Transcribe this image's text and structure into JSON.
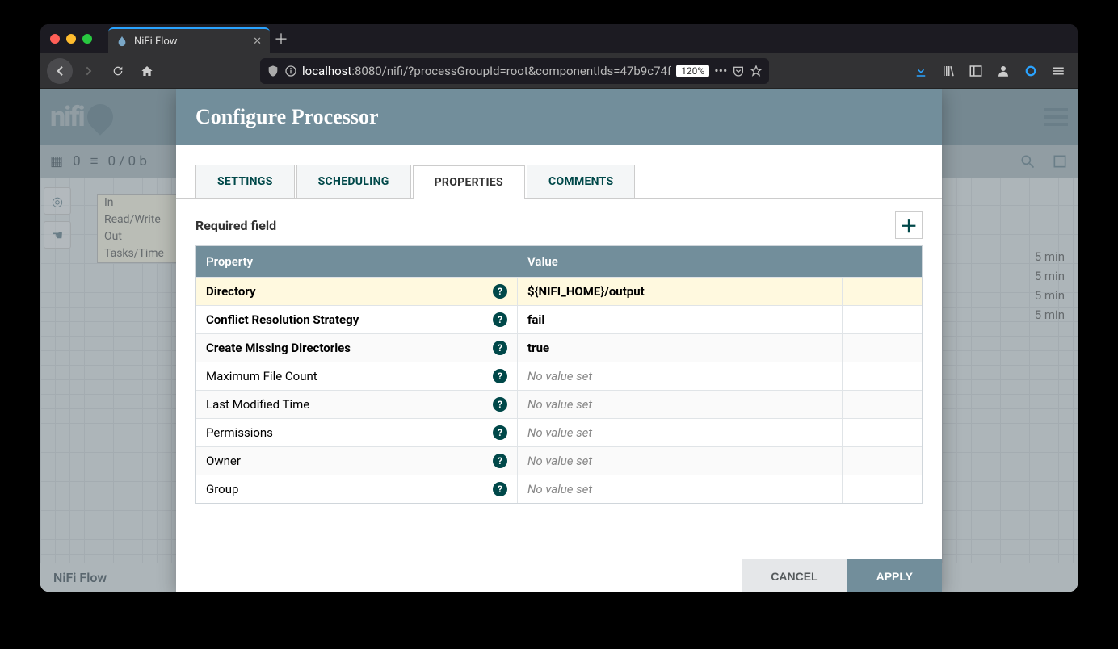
{
  "browser": {
    "tab_title": "NiFi Flow",
    "url_host": "localhost",
    "url_rest": ":8080/nifi/?processGroupId=root&componentIds=47b9c74f",
    "zoom": "120%"
  },
  "app": {
    "logo_text": "nifi",
    "status_count": "0",
    "status_bytes": "0 / 0 b",
    "breadcrumb": "NiFi Flow"
  },
  "proc_card": {
    "rows": [
      "In",
      "Read/Write",
      "Out",
      "Tasks/Time"
    ]
  },
  "side_times": [
    "5 min",
    "5 min",
    "5 min",
    "5 min"
  ],
  "dialog": {
    "title": "Configure Processor",
    "tabs": [
      "SETTINGS",
      "SCHEDULING",
      "PROPERTIES",
      "COMMENTS"
    ],
    "active_tab": 2,
    "required_label": "Required field",
    "header_prop": "Property",
    "header_val": "Value",
    "rows": [
      {
        "name": "Directory",
        "required": true,
        "value": "${NIFI_HOME}/output",
        "selected": true,
        "no_value": false
      },
      {
        "name": "Conflict Resolution Strategy",
        "required": true,
        "value": "fail",
        "selected": false,
        "no_value": false
      },
      {
        "name": "Create Missing Directories",
        "required": true,
        "value": "true",
        "selected": false,
        "no_value": false
      },
      {
        "name": "Maximum File Count",
        "required": false,
        "value": "No value set",
        "selected": false,
        "no_value": true
      },
      {
        "name": "Last Modified Time",
        "required": false,
        "value": "No value set",
        "selected": false,
        "no_value": true
      },
      {
        "name": "Permissions",
        "required": false,
        "value": "No value set",
        "selected": false,
        "no_value": true
      },
      {
        "name": "Owner",
        "required": false,
        "value": "No value set",
        "selected": false,
        "no_value": true
      },
      {
        "name": "Group",
        "required": false,
        "value": "No value set",
        "selected": false,
        "no_value": true
      }
    ],
    "cancel": "CANCEL",
    "apply": "APPLY"
  }
}
